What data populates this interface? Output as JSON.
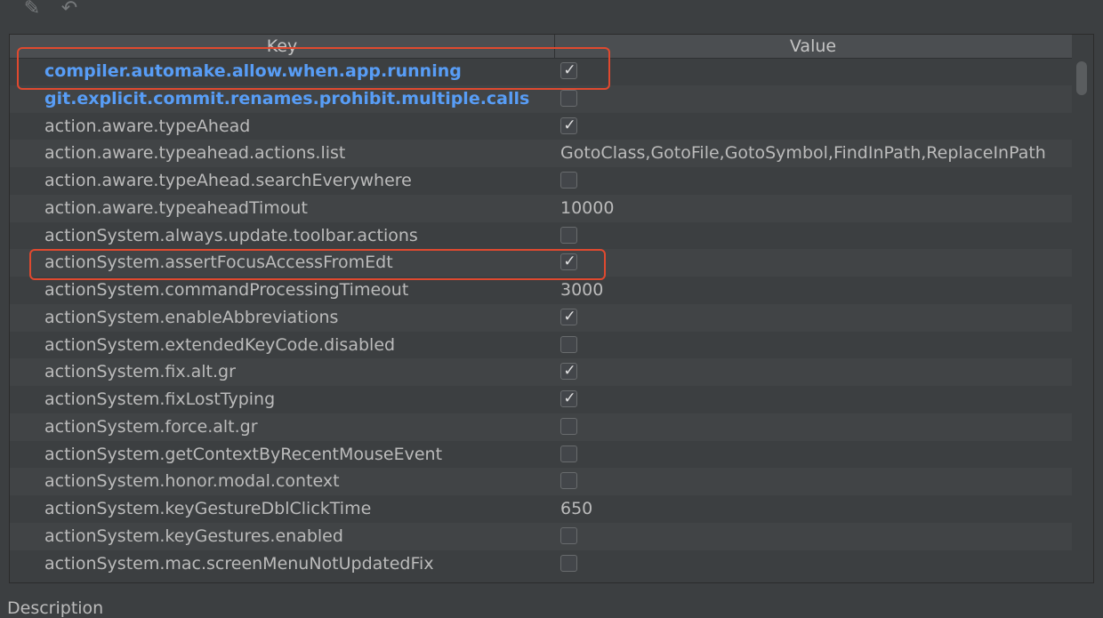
{
  "table": {
    "headers": {
      "key": "Key",
      "value": "Value"
    },
    "rows": [
      {
        "key": "compiler.automake.allow.when.app.running",
        "modified": true,
        "checkbox": true,
        "checked": true,
        "value": ""
      },
      {
        "key": "git.explicit.commit.renames.prohibit.multiple.calls",
        "modified": true,
        "checkbox": true,
        "checked": false,
        "value": ""
      },
      {
        "key": "action.aware.typeAhead",
        "modified": false,
        "checkbox": true,
        "checked": true,
        "value": ""
      },
      {
        "key": "action.aware.typeahead.actions.list",
        "modified": false,
        "checkbox": false,
        "checked": false,
        "value": "GotoClass,GotoFile,GotoSymbol,FindInPath,ReplaceInPath"
      },
      {
        "key": "action.aware.typeAhead.searchEverywhere",
        "modified": false,
        "checkbox": true,
        "checked": false,
        "value": ""
      },
      {
        "key": "action.aware.typeaheadTimout",
        "modified": false,
        "checkbox": false,
        "checked": false,
        "value": "10000"
      },
      {
        "key": "actionSystem.always.update.toolbar.actions",
        "modified": false,
        "checkbox": true,
        "checked": false,
        "value": ""
      },
      {
        "key": "actionSystem.assertFocusAccessFromEdt",
        "modified": false,
        "checkbox": true,
        "checked": true,
        "value": ""
      },
      {
        "key": "actionSystem.commandProcessingTimeout",
        "modified": false,
        "checkbox": false,
        "checked": false,
        "value": "3000"
      },
      {
        "key": "actionSystem.enableAbbreviations",
        "modified": false,
        "checkbox": true,
        "checked": true,
        "value": ""
      },
      {
        "key": "actionSystem.extendedKeyCode.disabled",
        "modified": false,
        "checkbox": true,
        "checked": false,
        "value": ""
      },
      {
        "key": "actionSystem.fix.alt.gr",
        "modified": false,
        "checkbox": true,
        "checked": true,
        "value": ""
      },
      {
        "key": "actionSystem.fixLostTyping",
        "modified": false,
        "checkbox": true,
        "checked": true,
        "value": ""
      },
      {
        "key": "actionSystem.force.alt.gr",
        "modified": false,
        "checkbox": true,
        "checked": false,
        "value": ""
      },
      {
        "key": "actionSystem.getContextByRecentMouseEvent",
        "modified": false,
        "checkbox": true,
        "checked": false,
        "value": ""
      },
      {
        "key": "actionSystem.honor.modal.context",
        "modified": false,
        "checkbox": true,
        "checked": false,
        "value": ""
      },
      {
        "key": "actionSystem.keyGestureDblClickTime",
        "modified": false,
        "checkbox": false,
        "checked": false,
        "value": "650"
      },
      {
        "key": "actionSystem.keyGestures.enabled",
        "modified": false,
        "checkbox": true,
        "checked": false,
        "value": ""
      },
      {
        "key": "actionSystem.mac.screenMenuNotUpdatedFix",
        "modified": false,
        "checkbox": true,
        "checked": false,
        "value": ""
      }
    ]
  },
  "description": {
    "label": "Description"
  },
  "icons": {
    "edit": "pencil-icon",
    "undo": "undo-icon",
    "check": "check-icon"
  },
  "colors": {
    "background": "#3c3f41",
    "modified_key": "#589df6",
    "highlight": "#e0492f"
  }
}
